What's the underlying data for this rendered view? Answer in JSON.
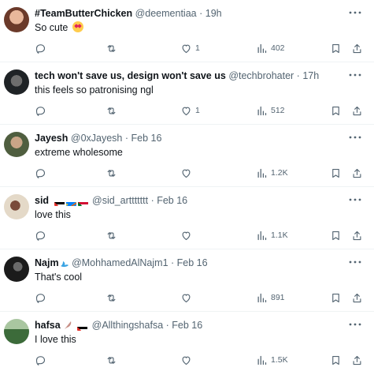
{
  "tweets": [
    {
      "name": "#TeamButterChicken",
      "handle": "@deementiaa",
      "time": "19h",
      "text": "So cute",
      "emoji": "heart-eyes",
      "replies": "",
      "retweets": "",
      "likes": "1",
      "views": "402",
      "avatar_color": "#c98b6c"
    },
    {
      "name": "tech won't save us, design won't save us",
      "handle": "@techbrohater",
      "time": "17h",
      "text": "this feels so patronising ngl",
      "replies": "",
      "retweets": "",
      "likes": "1",
      "views": "512",
      "avatar_color": "#3a3f45"
    },
    {
      "name": "Jayesh",
      "handle": "@0xJayesh",
      "time": "Feb 16",
      "text": "extreme wholesome",
      "replies": "",
      "retweets": "",
      "likes": "",
      "views": "1.2K",
      "avatar_color": "#5a6b4a"
    },
    {
      "name": "sid",
      "handle": "@sid_arttttttt",
      "time": "Feb 16",
      "text": "love this",
      "flags": [
        "palestine",
        "congo",
        "sudan"
      ],
      "replies": "",
      "retweets": "",
      "likes": "",
      "views": "1.1K",
      "avatar_color": "#d7c8b4"
    },
    {
      "name": "Najm",
      "handle": "@MohhamedAlNajm1",
      "time": "Feb 16",
      "text": "That's cool",
      "replies": "",
      "retweets": "",
      "likes": "",
      "views": "891",
      "avatar_color": "#2b2b2b"
    },
    {
      "name": "hafsa",
      "handle": "@Allthingshafsa",
      "time": "Feb 16",
      "text": "I love this",
      "flags": [
        "palestine"
      ],
      "replies": "",
      "retweets": "",
      "likes": "",
      "views": "1.5K",
      "avatar_color": "#3c6b3a"
    }
  ],
  "separator": "·",
  "colors": {
    "text": "#0f1419",
    "muted": "#536471",
    "divider": "#eff3f4"
  }
}
